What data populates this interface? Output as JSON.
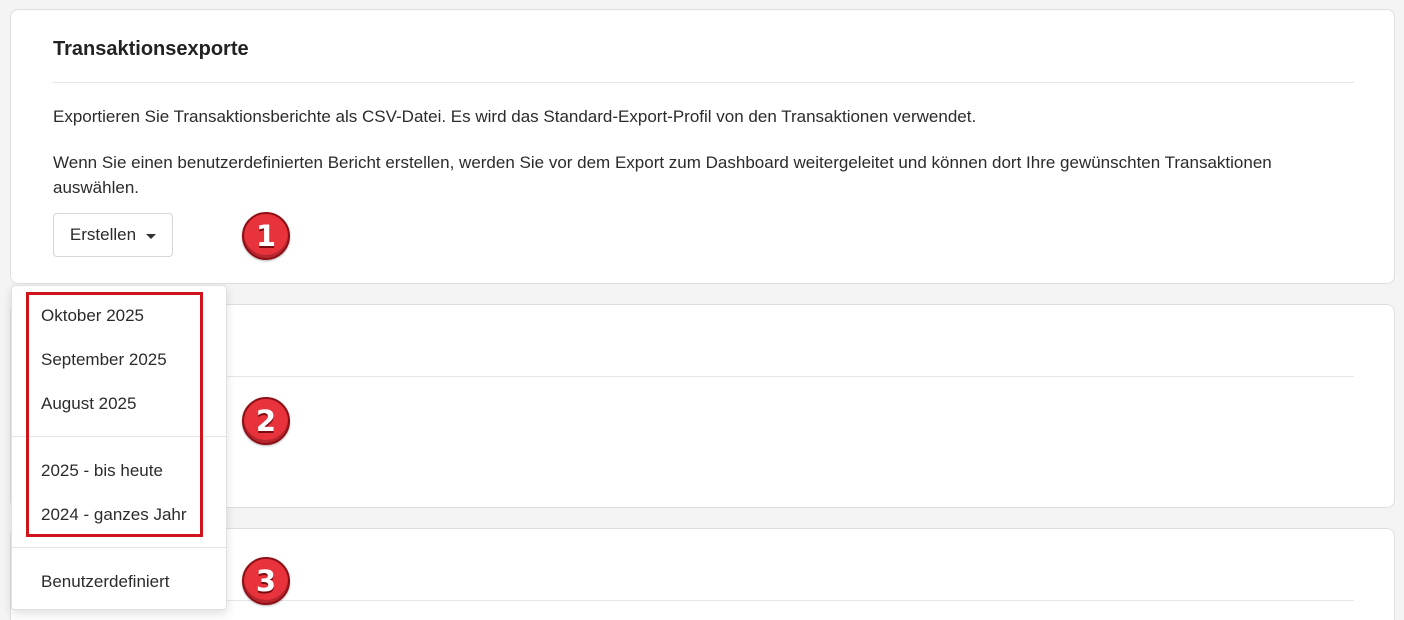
{
  "main_card": {
    "title": "Transaktionsexporte",
    "paragraph_1": "Exportieren Sie Transaktionsberichte als CSV-Datei. Es wird das Standard-Export-Profil von den Transaktionen verwendet.",
    "paragraph_2": "Wenn Sie einen benutzerdefinierten Bericht erstellen, werden Sie vor dem Export zum Dashboard weitergeleitet und können dort Ihre gewünschten Transaktionen auswählen.",
    "create_button_label": "Erstellen"
  },
  "dropdown": {
    "items": [
      "Oktober 2025",
      "September 2025",
      "August 2025",
      "2025 - bis heute",
      "2024 - ganzes Jahr",
      "Benutzerdefiniert"
    ]
  },
  "annotations": {
    "step_1": "1",
    "step_2": "2",
    "step_3": "3",
    "badge_color": "#e8323c",
    "highlight_color": "#d0141b"
  }
}
